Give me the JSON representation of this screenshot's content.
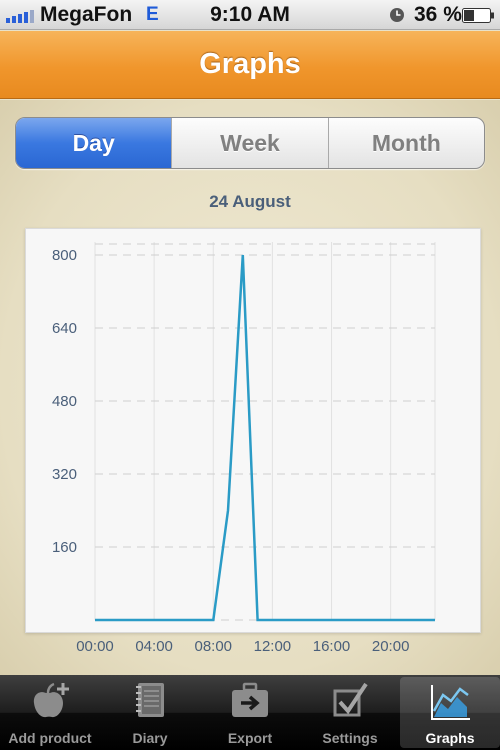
{
  "status_bar": {
    "carrier": "MegaFon",
    "network": "E",
    "time": "9:10 AM",
    "battery": "36 %"
  },
  "nav": {
    "title": "Graphs"
  },
  "segments": [
    {
      "label": "Day",
      "active": true
    },
    {
      "label": "Week",
      "active": false
    },
    {
      "label": "Month",
      "active": false
    }
  ],
  "date_label": "24 August",
  "chart_data": {
    "type": "line",
    "x_ticks": [
      "00:00",
      "04:00",
      "08:00",
      "12:00",
      "16:00",
      "20:00"
    ],
    "y_ticks": [
      160,
      320,
      480,
      640,
      800
    ],
    "ylim": [
      0,
      800
    ],
    "xlim_hours": [
      0,
      23
    ],
    "grid": true,
    "color": "#2a9bc6",
    "series": [
      {
        "points": [
          {
            "x": 0,
            "y": 0
          },
          {
            "x": 8,
            "y": 0
          },
          {
            "x": 9,
            "y": 240
          },
          {
            "x": 10,
            "y": 800
          },
          {
            "x": 11,
            "y": 0
          },
          {
            "x": 23,
            "y": 0
          }
        ]
      }
    ]
  },
  "tabs": [
    {
      "label": "Add product",
      "icon": "apple-plus-icon",
      "selected": false
    },
    {
      "label": "Diary",
      "icon": "notebook-icon",
      "selected": false
    },
    {
      "label": "Export",
      "icon": "briefcase-arrow-icon",
      "selected": false
    },
    {
      "label": "Settings",
      "icon": "checkbox-icon",
      "selected": false
    },
    {
      "label": "Graphs",
      "icon": "graph-icon",
      "selected": true
    }
  ],
  "colors": {
    "accent_orange": "#f0962c",
    "segment_blue": "#3a78e0",
    "axis_text": "#4a5f7a"
  }
}
